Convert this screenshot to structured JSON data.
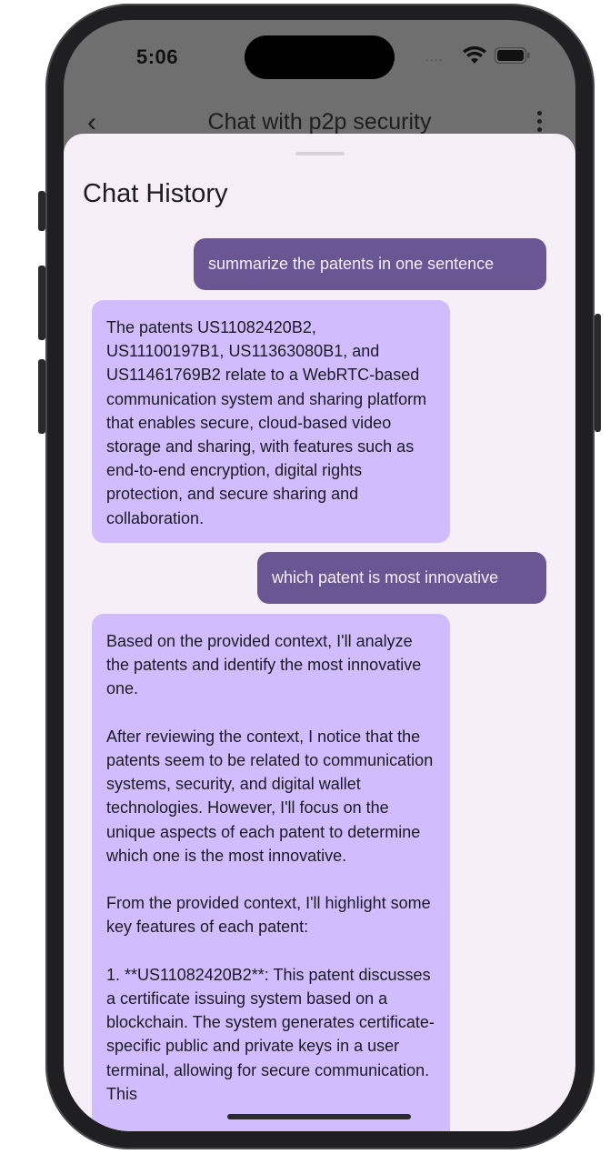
{
  "status_bar": {
    "time": "5:06"
  },
  "header": {
    "title": "Chat with p2p security"
  },
  "sheet": {
    "title": "Chat History"
  },
  "messages": [
    {
      "role": "user",
      "text": "summarize the patents in one sentence"
    },
    {
      "role": "assistant",
      "text": "The patents US11082420B2, US11100197B1, US11363080B1, and US11461769B2 relate to a WebRTC-based communication system and sharing platform that enables secure, cloud-based video storage and sharing, with features such as end-to-end encryption, digital rights protection, and secure sharing and collaboration."
    },
    {
      "role": "user",
      "text": "which patent is most innovative"
    },
    {
      "role": "assistant",
      "text": "Based on the provided context, I'll analyze the patents and identify the most innovative one.\n\nAfter reviewing the context, I notice that the patents seem to be related to communication systems, security, and digital wallet technologies. However, I'll focus on the unique aspects of each patent to determine which one is the most innovative.\n\nFrom the provided context, I'll highlight some key features of each patent:\n\n1. **US11082420B2**: This patent discusses a certificate issuing system based on a blockchain. The system generates certificate-specific public and private keys in a user terminal, allowing for secure communication. This"
    }
  ],
  "icons": {
    "back": "chevron-left-icon",
    "more": "more-vert-icon",
    "wifi": "wifi-icon",
    "battery": "battery-icon"
  },
  "colors": {
    "sheet_bg": "#f6eff8",
    "user_bubble": "#6b5694",
    "bot_bubble": "#d0bcff"
  }
}
